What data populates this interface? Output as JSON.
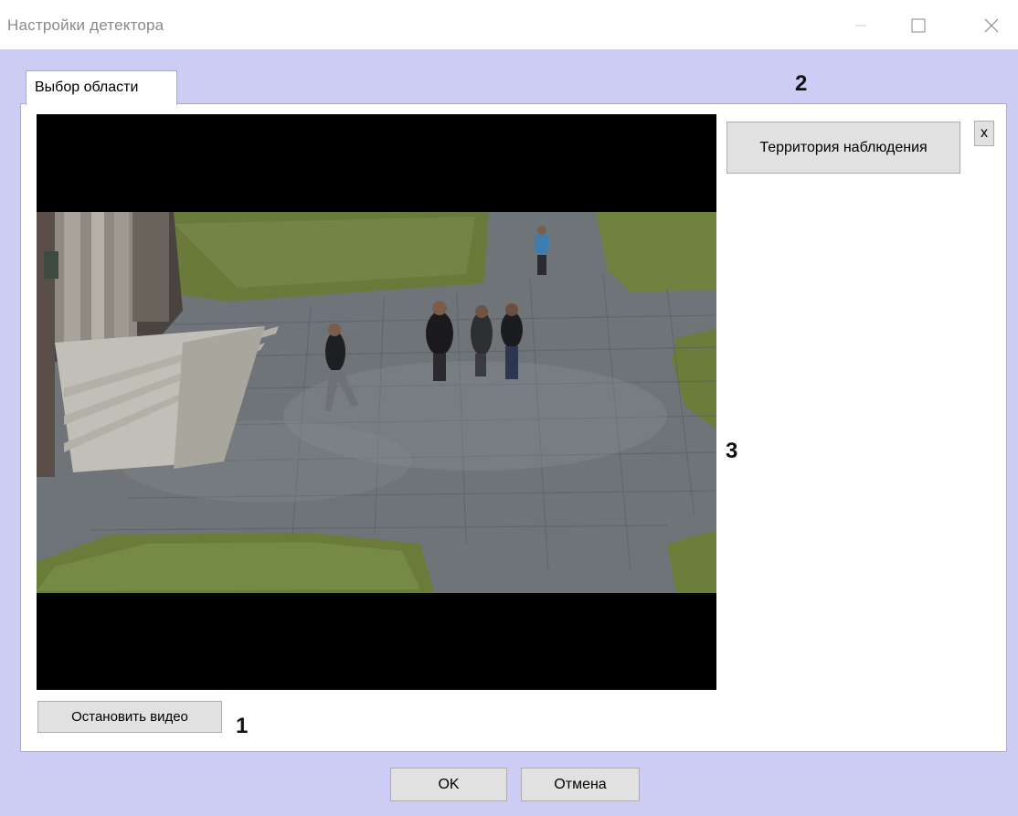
{
  "window": {
    "title": "Настройки детектора",
    "controls": {
      "minimize_icon": "minimize-icon",
      "maximize_icon": "maximize-icon",
      "close_icon": "close-icon"
    }
  },
  "tabs": [
    {
      "label": "Выбор области",
      "selected": true
    }
  ],
  "areas": {
    "add_label": "Территория наблюдения",
    "remove_label": "x"
  },
  "video": {
    "stop_label": "Остановить видео"
  },
  "footer": {
    "ok_label": "OK",
    "cancel_label": "Отмена"
  },
  "markers": {
    "one": "1",
    "two": "2",
    "three": "3"
  },
  "colors": {
    "client_background": "#ccccf5",
    "panel_background": "#ffffff",
    "button_face": "#e1e1e1",
    "video_letterbox": "#000000"
  }
}
